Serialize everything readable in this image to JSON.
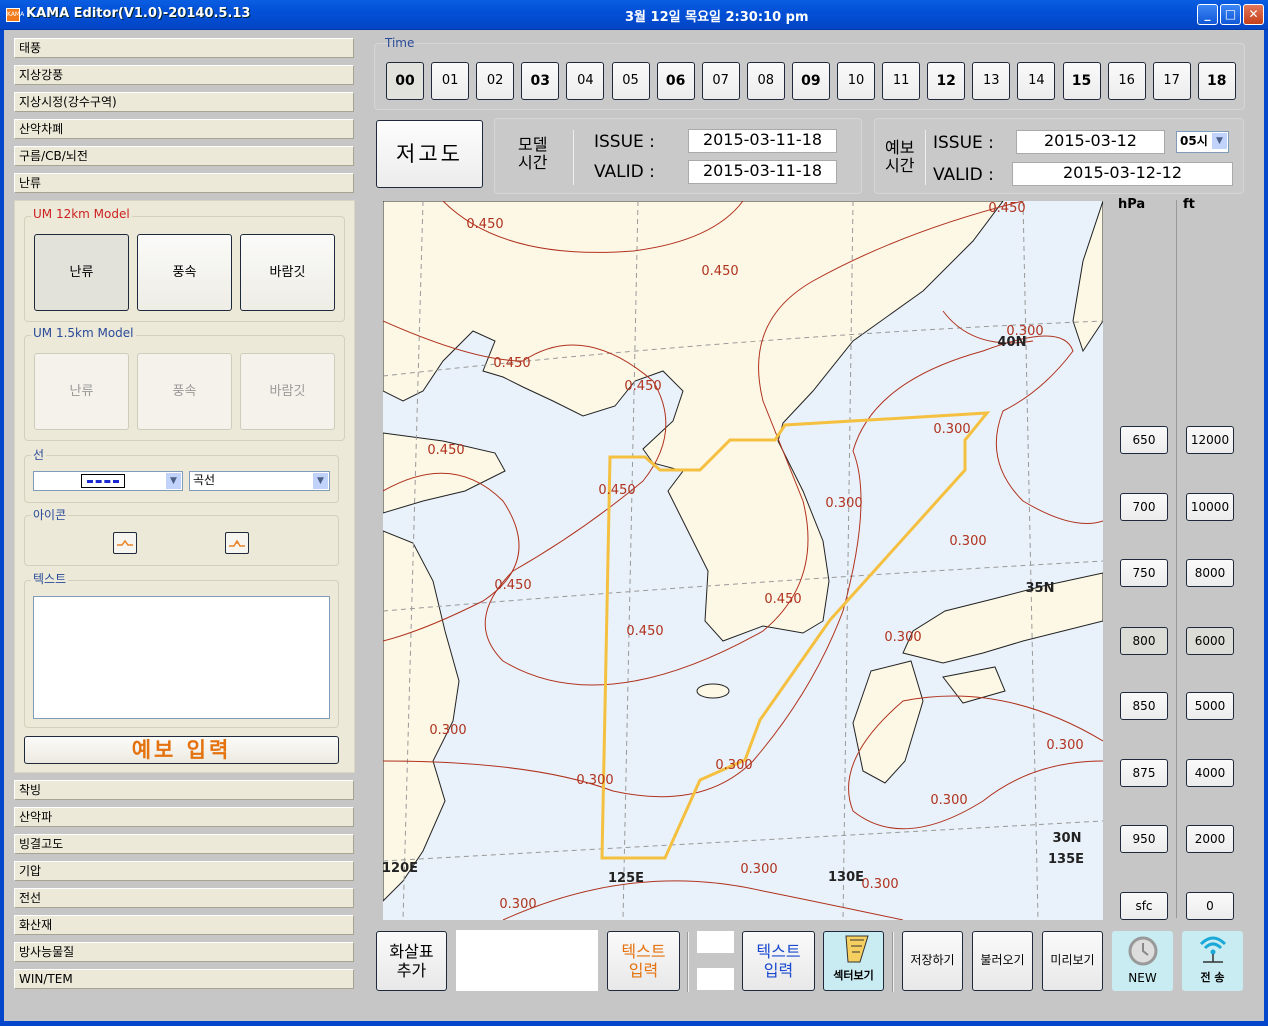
{
  "window": {
    "title": "KAMA Editor(V1.0)-20140.5.13",
    "clock": "3월 12일  목요일  2:30:10 pm",
    "app_icon": "KAMA",
    "minimize": "_",
    "maximize": "□",
    "close": "✕"
  },
  "sidebar": {
    "top_items": [
      "태풍",
      "지상강풍",
      "지상시정(강수구역)",
      "산악차폐",
      "구름/CB/뇌전",
      "난류"
    ],
    "bottom_items": [
      "착빙",
      "산악파",
      "빙결고도",
      "기압",
      "전선",
      "화산재",
      "방사능물질",
      "WIN/TEM"
    ]
  },
  "panel": {
    "um12": {
      "label": "UM 12km Model",
      "buttons": [
        "난류",
        "풍속",
        "바람깃"
      ],
      "color": "#cc2222"
    },
    "um15": {
      "label": "UM 1.5km Model",
      "buttons": [
        "난류",
        "풍속",
        "바람깃"
      ]
    },
    "line": {
      "label": "선",
      "style_value": "dashed",
      "type_value": "곡선"
    },
    "icon": {
      "label": "아이콘"
    },
    "text": {
      "label": "텍스트",
      "value": ""
    },
    "forecast_input": "예보 입력"
  },
  "time": {
    "label": "Time",
    "selected": "00",
    "bold": [
      "00",
      "03",
      "06",
      "09",
      "12",
      "15",
      "18"
    ],
    "hours": [
      "00",
      "01",
      "02",
      "03",
      "04",
      "05",
      "06",
      "07",
      "08",
      "09",
      "10",
      "11",
      "12",
      "13",
      "14",
      "15",
      "16",
      "17",
      "18"
    ]
  },
  "low_level_button": "저고도",
  "model_time": {
    "label_line1": "모델",
    "label_line2": "시간",
    "issue_label": "ISSUE :",
    "valid_label": "VALID :",
    "issue": "2015-03-11-18",
    "valid": "2015-03-11-18"
  },
  "forecast_time": {
    "label_line1": "예보",
    "label_line2": "시간",
    "issue_label": "ISSUE :",
    "valid_label": "VALID :",
    "issue": "2015-03-12",
    "hour": "05시",
    "valid": "2015-03-12-12"
  },
  "map": {
    "colors": {
      "land": "#fdf8e6",
      "sea": "#e9f2fa",
      "contour": "#b0321e",
      "sector": "#f5c040"
    },
    "contour_labels": [
      "0.450",
      "0.450",
      "0.450",
      "0.450",
      "0.450",
      "0.450",
      "0.450",
      "0.450",
      "0.450",
      "0.450",
      "0.300",
      "0.300",
      "0.300",
      "0.300",
      "0.300",
      "0.300",
      "0.300",
      "0.300",
      "0.300",
      "0.300",
      "0.300",
      "0.300",
      "0.300"
    ],
    "grid_labels": [
      "40N",
      "35N",
      "30N",
      "135E",
      "120E",
      "125E",
      "130E"
    ]
  },
  "levels": {
    "hpa_label": "hPa",
    "ft_label": "ft",
    "hpa": [
      "650",
      "700",
      "750",
      "800",
      "850",
      "875",
      "950",
      "sfc"
    ],
    "ft": [
      "12000",
      "10000",
      "8000",
      "6000",
      "5000",
      "4000",
      "2000",
      "0"
    ],
    "selected_index": 3
  },
  "toolbar": {
    "arrow_add": [
      "화살표",
      "추가"
    ],
    "text_input_orange": [
      "텍스트",
      "입력"
    ],
    "text_input_blue": [
      "텍스트",
      "입력"
    ],
    "sector_view": "섹터보기",
    "save": "저장하기",
    "load": "불러오기",
    "preview": "미리보기",
    "new": "NEW",
    "send": "전  송"
  }
}
